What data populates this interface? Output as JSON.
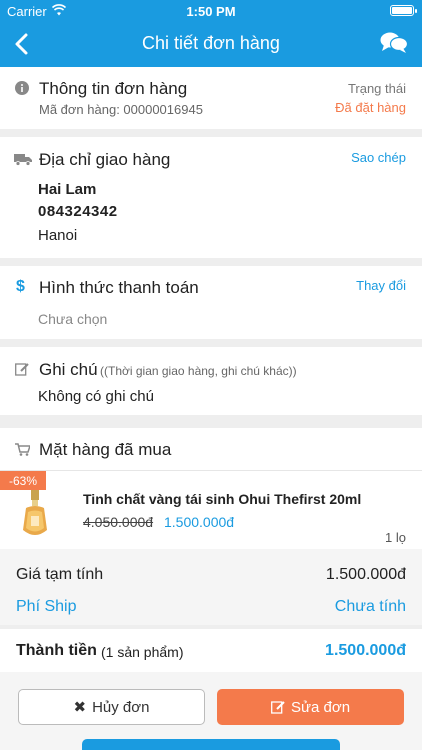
{
  "status_bar": {
    "carrier": "Carrier",
    "time": "1:50 PM"
  },
  "nav": {
    "title": "Chi tiết đơn hàng"
  },
  "order_info": {
    "title": "Thông tin đơn hàng",
    "order_code": "Mã đơn hàng: 00000016945",
    "status_label": "Trạng thái",
    "status_value": "Đã đặt hàng"
  },
  "shipping": {
    "title": "Địa chỉ giao hàng",
    "copy_label": "Sao chép",
    "name": "Hai Lam",
    "phone": "084324342",
    "address": "Hanoi"
  },
  "payment": {
    "title": "Hình thức thanh toán",
    "change_label": "Thay đổi",
    "value": "Chưa chọn"
  },
  "note": {
    "title": "Ghi chú",
    "hint": "((Thời gian giao hàng, ghi chú khác))",
    "value": "Không có ghi chú"
  },
  "items": {
    "title": "Mặt hàng đã mua",
    "product": {
      "discount": "-63%",
      "name": "Tinh chất vàng tái sinh Ohui Thefirst 20ml",
      "old_price": "4.050.000đ",
      "new_price": "1.500.000đ",
      "quantity": "1 lọ"
    }
  },
  "summary": {
    "subtotal_label": "Giá tạm tính",
    "subtotal_value": "1.500.000đ",
    "shipping_label": "Phí Ship",
    "shipping_value": "Chưa tính",
    "total_label": "Thành tiền",
    "total_count": "(1 sản phẩm)",
    "total_value": "1.500.000đ"
  },
  "actions": {
    "cancel_label": "Hủy đơn",
    "edit_label": "Sửa đơn"
  },
  "colors": {
    "primary": "#1a9be0",
    "accent": "#f47a4b",
    "status": "#f47a4b"
  }
}
